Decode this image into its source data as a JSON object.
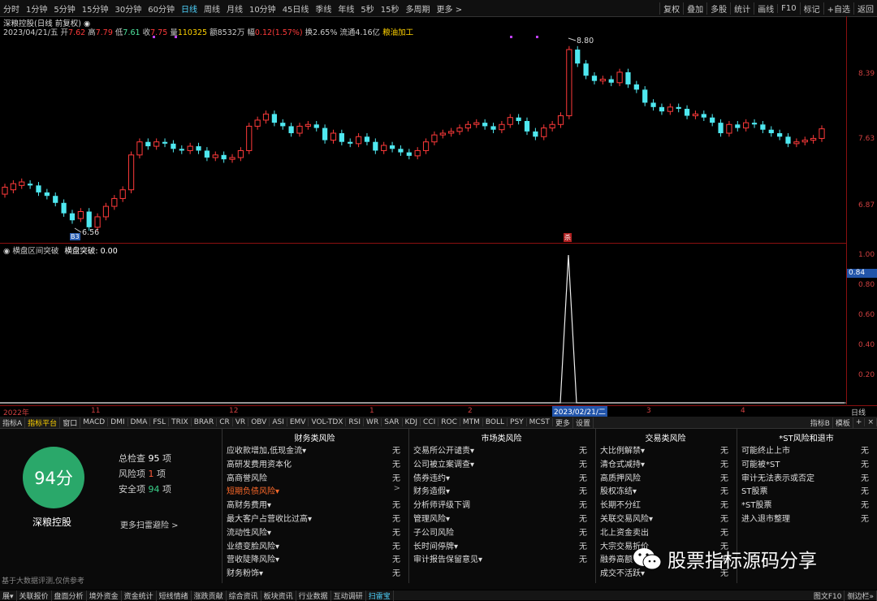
{
  "toolbar": {
    "timeframes": [
      "分时",
      "1分钟",
      "5分钟",
      "15分钟",
      "30分钟",
      "60分钟",
      "日线",
      "周线",
      "月线",
      "10分钟",
      "45日线",
      "季线",
      "年线",
      "5秒",
      "15秒",
      "多周期",
      "更多 >"
    ],
    "active": "日线",
    "right_buttons": [
      "复权",
      "叠加",
      "多股",
      "统计",
      "画线",
      "F10",
      "标记",
      "+自选",
      "返回"
    ]
  },
  "header": {
    "stock_line": "深粮控股(日线 前复权) ◉",
    "date": "2023/04/21/五",
    "open_label": "开",
    "open": "7.62",
    "high_label": "高",
    "high": "7.79",
    "low_label": "低",
    "low": "7.61",
    "close_label": "收",
    "close": "7.75",
    "vol_label": "量",
    "vol": "110325",
    "amt_label": "额",
    "amt": "8532万",
    "chg_label": "幅",
    "chg": "0.12(1.57%)",
    "turnover_label": "换",
    "turnover": "2.65%",
    "float_label": "流通",
    "float": "4.16亿",
    "industry": "粮油加工"
  },
  "price_axis": [
    "8.39",
    "7.63",
    "6.87"
  ],
  "annotations": {
    "high_price": "8.80",
    "low_price": "6.56",
    "low_badge": "B3",
    "event_badge": "杀"
  },
  "indicator": {
    "name_label": "横盘区间突破",
    "value_label": "横盘突破: 0.00",
    "axis": [
      "1.00",
      "0.80",
      "0.60",
      "0.40",
      "0.20"
    ],
    "current": "0.84"
  },
  "date_axis": [
    "2022年",
    "11",
    "12",
    "1",
    "2",
    "2023/02/21/二",
    "3",
    "4"
  ],
  "date_axis_right": "日线",
  "tabs": [
    "指标A",
    "指标平台",
    "窗口",
    "MACD",
    "DMI",
    "DMA",
    "FSL",
    "TRIX",
    "BRAR",
    "CR",
    "VR",
    "OBV",
    "ASI",
    "EMV",
    "VOL-TDX",
    "RSI",
    "WR",
    "SAR",
    "KDJ",
    "CCI",
    "ROC",
    "MTM",
    "BOLL",
    "PSY",
    "MCST",
    "更多",
    "设置"
  ],
  "tabs_selected": "指标平台",
  "tabs_right": [
    "指标B",
    "模板",
    "+",
    "×"
  ],
  "risk": {
    "score": "94分",
    "stock_name": "深粮控股",
    "total_label": "总检查",
    "total": "95",
    "total_unit": "项",
    "risk_label": "风险项",
    "risk_count": "1",
    "risk_unit": "项",
    "safe_label": "安全项",
    "safe": "94",
    "safe_unit": "项",
    "more": "更多扫雷避险 >",
    "disclaimer": "基于大数据评测,仅供参考",
    "columns": [
      {
        "title": "财务类风险",
        "items": [
          {
            "label": "应收款增加,低现金流▾",
            "value": "无"
          },
          {
            "label": "高研发费用资本化",
            "value": "无"
          },
          {
            "label": "高商誉风险",
            "value": "无"
          },
          {
            "label": "短期负债风险▾",
            "value": ">"
          },
          {
            "label": "高财务费用▾",
            "value": "无"
          },
          {
            "label": "最大客户占营收比过高▾",
            "value": "无"
          },
          {
            "label": "流动性风险▾",
            "value": "无"
          },
          {
            "label": "业绩变脸风险▾",
            "value": "无"
          },
          {
            "label": "营收陡降风险▾",
            "value": "无"
          },
          {
            "label": "财务粉饰▾",
            "value": "无"
          }
        ]
      },
      {
        "title": "市场类风险",
        "items": [
          {
            "label": "交易所公开谴责▾",
            "value": "无"
          },
          {
            "label": "公司被立案调查▾",
            "value": "无"
          },
          {
            "label": "债券违约▾",
            "value": "无"
          },
          {
            "label": "财务造假▾",
            "value": "无"
          },
          {
            "label": "分析师评级下调",
            "value": "无"
          },
          {
            "label": "管理风险▾",
            "value": "无"
          },
          {
            "label": "子公司风险",
            "value": "无"
          },
          {
            "label": "长时间停牌▾",
            "value": "无"
          },
          {
            "label": "审计报告保留意见▾",
            "value": "无"
          }
        ]
      },
      {
        "title": "交易类风险",
        "items": [
          {
            "label": "大比例解禁▾",
            "value": "无"
          },
          {
            "label": "清仓式减持▾",
            "value": "无"
          },
          {
            "label": "高质押风险",
            "value": "无"
          },
          {
            "label": "股权冻结▾",
            "value": "无"
          },
          {
            "label": "长期不分红",
            "value": "无"
          },
          {
            "label": "关联交易风险▾",
            "value": "无"
          },
          {
            "label": "北上资金卖出",
            "value": "无"
          },
          {
            "label": "大宗交易折价",
            "value": "无"
          },
          {
            "label": "融券高额",
            "value": "无"
          },
          {
            "label": "成交不活跃▾",
            "value": "无"
          }
        ]
      },
      {
        "title": "*ST风险和退市",
        "items": [
          {
            "label": "可能终止上市",
            "value": "无"
          },
          {
            "label": "可能被*ST",
            "value": "无"
          },
          {
            "label": "审计无法表示或否定",
            "value": "无"
          },
          {
            "label": "ST股票",
            "value": "无"
          },
          {
            "label": "*ST股票",
            "value": "无"
          },
          {
            "label": "进入退市整理",
            "value": "无"
          }
        ]
      }
    ]
  },
  "bottom_tabs": [
    "展▾",
    "关联报价",
    "盘面分析",
    "境外资金",
    "资金统计",
    "短线情绪",
    "涨跌贡献",
    "综合资讯",
    "板块资讯",
    "行业数据",
    "互动调研",
    "扫雷宝"
  ],
  "bottom_tabs_selected": "扫雷宝",
  "bottom_right": [
    "图文F10",
    "侧边栏»"
  ],
  "watermark": "股票指标源码分享",
  "colors": {
    "up": "#ff3a3a",
    "down": "#4fe8f0",
    "accent": "#4fd4ff",
    "warn": "#ff6a2a",
    "score": "#2aa86a"
  }
}
